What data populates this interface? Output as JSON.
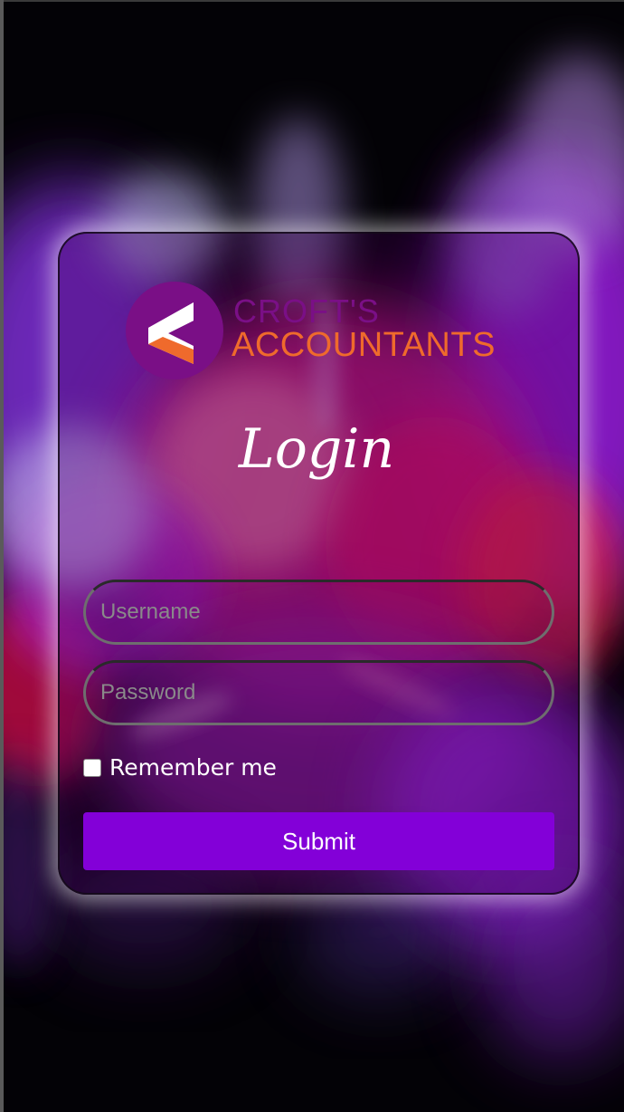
{
  "brand": {
    "line1": "CROFT'S",
    "line2": "ACCOUNTANTS",
    "logo_icon": "crofts-logo-icon",
    "colors": {
      "purple": "#7a0f86",
      "orange": "#ef6a2c"
    }
  },
  "login": {
    "title": "Login"
  },
  "form": {
    "username_placeholder": "Username",
    "password_placeholder": "Password",
    "remember_label": "Remember me",
    "submit_label": "Submit"
  },
  "colors": {
    "accent": "#8300d8",
    "card_glow": "#ffffff"
  }
}
